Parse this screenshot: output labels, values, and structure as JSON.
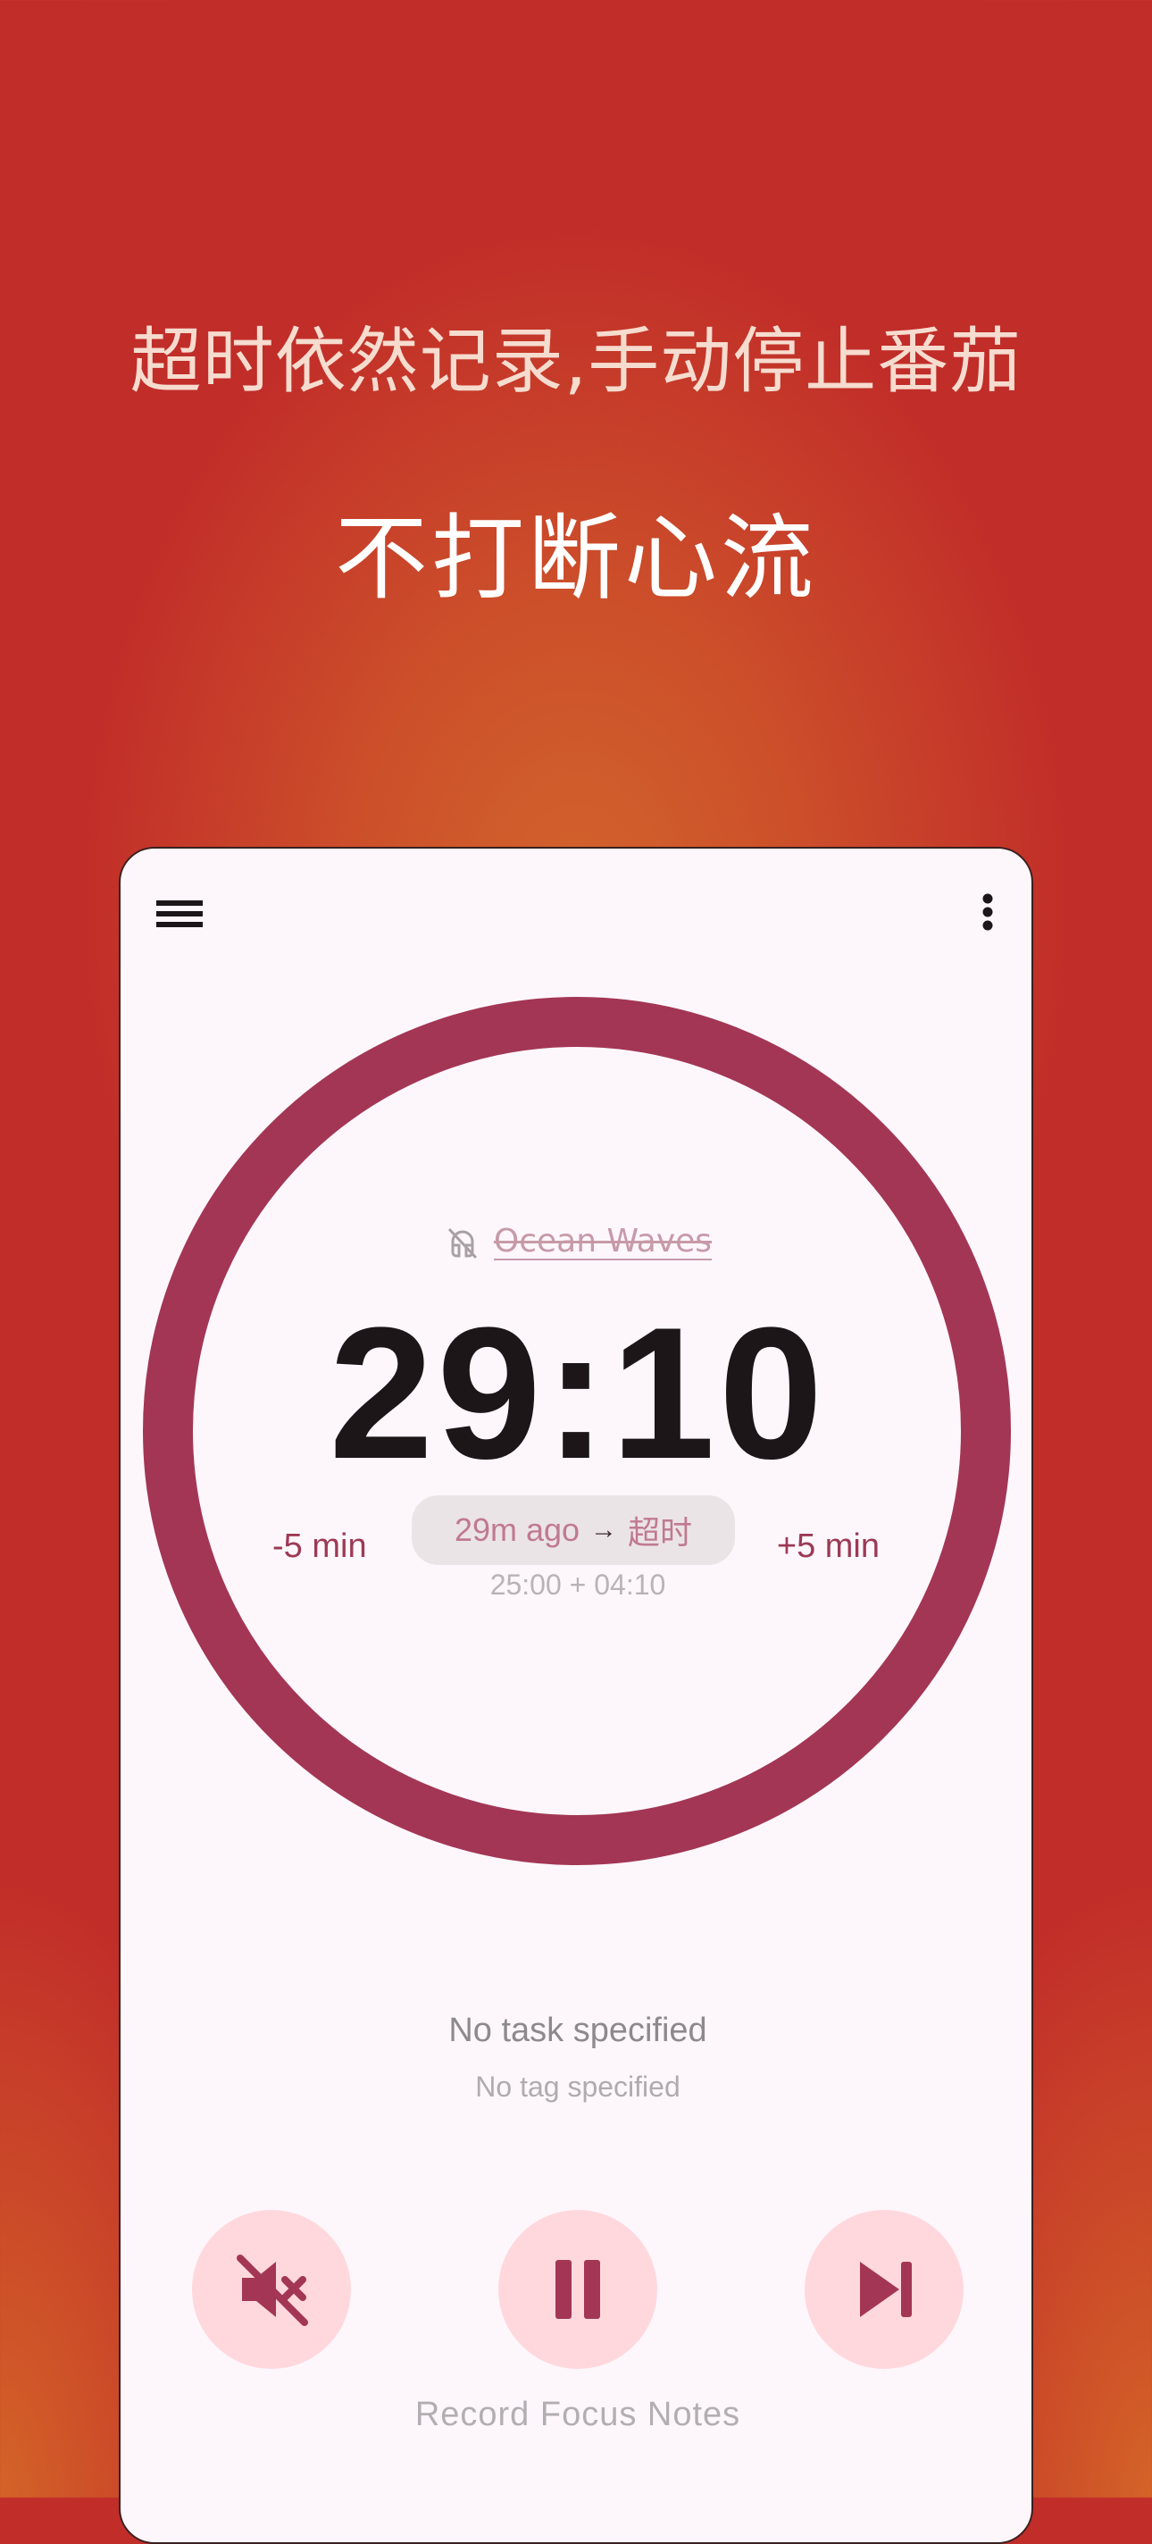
{
  "promo": {
    "subtitle": "超时依然记录,手动停止番茄",
    "title": "不打断心流"
  },
  "app": {
    "toolbar": {
      "menu_icon": "hamburger-menu-icon",
      "more_icon": "more-vertical-icon"
    },
    "sound": {
      "name": "Ocean Waves",
      "icon": "music-off-icon"
    },
    "timer": {
      "display": "29:10",
      "progress_fraction": 1.0
    },
    "adjust": {
      "minus_label": "-5 min",
      "plus_label": "+5 min"
    },
    "overtime": {
      "ago": "29m ago",
      "arrow": "→",
      "status": "超时",
      "calculation": "25:00 + 04:10"
    },
    "task": {
      "label": "No task specified"
    },
    "tag": {
      "label": "No tag specified"
    },
    "controls": {
      "mute_icon": "volume-off-icon",
      "pause_icon": "pause-icon",
      "skip_icon": "skip-next-icon"
    },
    "notes_label": "Record Focus Notes"
  },
  "colors": {
    "background": "#c12d29",
    "ring": "#a33655",
    "accent_text": "#9c3a55",
    "button_bg": "#ffd8de",
    "button_icon": "#a33655",
    "card_bg": "#fdf7fc"
  }
}
